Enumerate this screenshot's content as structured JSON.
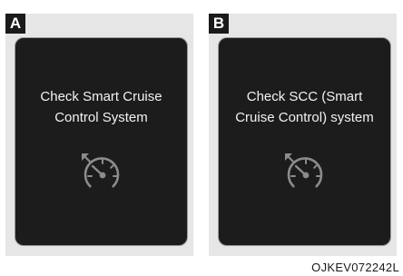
{
  "panels": [
    {
      "tag": "A",
      "message_lines": [
        "Check Smart Cruise",
        "Control System"
      ],
      "icon": "cruise-control-gauge-icon"
    },
    {
      "tag": "B",
      "message_lines": [
        "Check SCC (Smart",
        "Cruise Control) system"
      ],
      "icon": "cruise-control-gauge-icon"
    }
  ],
  "caption": "OJKEV072242L",
  "colors": {
    "panel_bg": "#e6e6e6",
    "screen_bg": "#1c1c1c",
    "screen_text": "#f2f2f2",
    "icon": "#8c8c8c",
    "tag_bg": "#1a1a1a"
  }
}
